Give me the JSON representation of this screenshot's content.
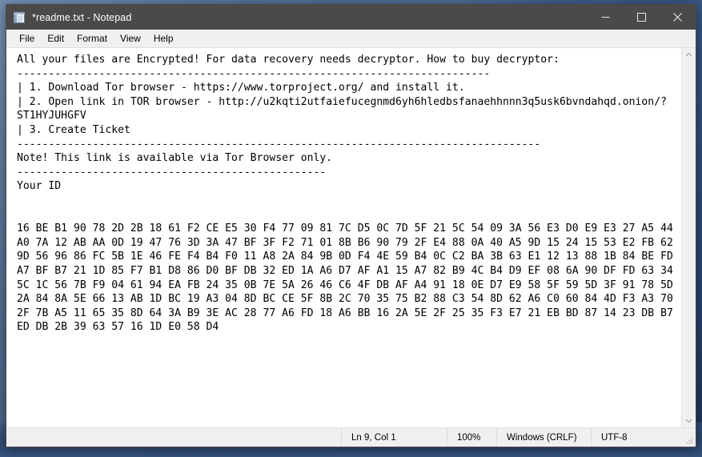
{
  "window": {
    "title": "*readme.txt - Notepad",
    "icon": "notepad-icon",
    "controls": {
      "minimize": "Minimize",
      "maximize": "Maximize",
      "close": "Close"
    }
  },
  "menu": {
    "items": [
      {
        "label": "File"
      },
      {
        "label": "Edit"
      },
      {
        "label": "Format"
      },
      {
        "label": "View"
      },
      {
        "label": "Help"
      }
    ]
  },
  "editor": {
    "lines": [
      "All your files are Encrypted! For data recovery needs decryptor. How to buy decryptor:",
      "---------------------------------------------------------------------------",
      "| 1. Download Tor browser - https://www.torproject.org/ and install it.",
      "| 2. Open link in TOR browser - http://u2kqti2utfaiefucegnmd6yh6hledbsfanaehhnnn3q5usk6bvndahqd.onion/?",
      "ST1HYJUHGFV",
      "| 3. Create Ticket",
      "-----------------------------------------------------------------------------------",
      "Note! This link is available via Tor Browser only.",
      "-------------------------------------------------",
      "Your ID",
      "",
      "",
      "16 BE B1 90 78 2D 2B 18 61 F2 CE E5 30 F4 77 09 81 7C D5 0C 7D 5F 21 5C 54 09 3A 56 E3 D0 E9 E3 27 A5 44",
      "A0 7A 12 AB AA 0D 19 47 76 3D 3A 47 BF 3F F2 71 01 8B B6 90 79 2F E4 88 0A 40 A5 9D 15 24 15 53 E2 FB 62",
      "9D 56 96 86 FC 5B 1E 46 FE F4 B4 F0 11 A8 2A 84 9B 0D F4 4E 59 B4 0C C2 BA 3B 63 E1 12 13 88 1B 84 BE FD",
      "A7 BF B7 21 1D 85 F7 B1 D8 86 D0 BF DB 32 ED 1A A6 D7 AF A1 15 A7 82 B9 4C B4 D9 EF 08 6A 90 DF FD 63 34",
      "5C 1C 56 7B F9 04 61 94 EA FB 24 35 0B 7E 5A 26 46 C6 4F DB AF A4 91 18 0E D7 E9 58 5F 59 5D 3F 91 78 5D",
      "2A 84 8A 5E 66 13 AB 1D BC 19 A3 04 8D BC CE 5F 8B 2C 70 35 75 B2 88 C3 54 8D 62 A6 C0 60 84 4D F3 A3 70",
      "2F 7B A5 11 65 35 8D 64 3A B9 3E AC 28 77 A6 FD 18 A6 BB 16 2A 5E 2F 25 35 F3 E7 21 EB BD 87 14 23 DB B7",
      "ED DB 2B 39 63 57 16 1D E0 58 D4"
    ]
  },
  "scrollbar": {
    "up_arrow": "chevron-up-icon",
    "down_arrow": "chevron-down-icon"
  },
  "status_bar": {
    "position": "Ln 9, Col 1",
    "zoom": "100%",
    "line_ending": "Windows (CRLF)",
    "encoding": "UTF-8"
  },
  "colors": {
    "title_bar": "#4c4a48",
    "chrome": "#f0f0f0",
    "editor_background": "#ffffff",
    "text": "#000000",
    "desktop": "#2f4d76"
  }
}
